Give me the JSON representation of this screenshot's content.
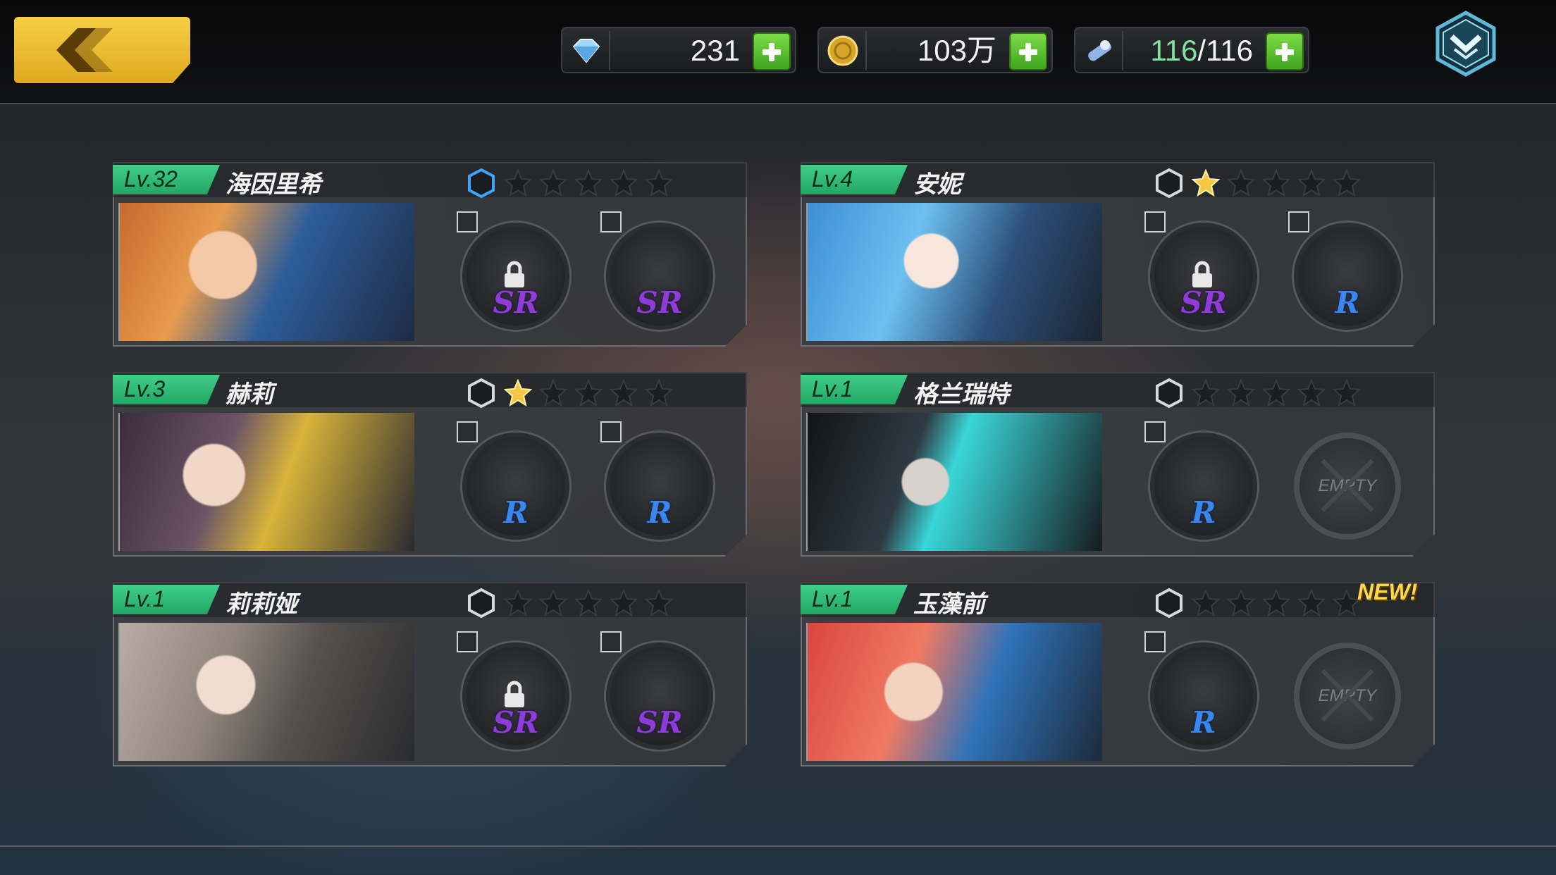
{
  "resources": {
    "diamonds": {
      "icon": "diamond-icon",
      "value": "231"
    },
    "gold": {
      "icon": "gold-coin-icon",
      "value": "103万"
    },
    "stamina": {
      "icon": "stamina-icon",
      "current": "116",
      "max": "116",
      "sep": "/"
    }
  },
  "nav": {
    "back_icon": "back-arrow-icon",
    "menu_icon": "chevron-menu-icon"
  },
  "empty_label": "EMPTY",
  "new_label": "NEW!",
  "characters": [
    {
      "level": "Lv.32",
      "name": "海因里希",
      "stars": 0,
      "hex_active": true,
      "slots": [
        {
          "rank": "SR",
          "locked": true
        },
        {
          "rank": "SR",
          "locked": false
        }
      ],
      "is_new": false
    },
    {
      "level": "Lv.4",
      "name": "安妮",
      "stars": 1,
      "hex_active": false,
      "slots": [
        {
          "rank": "SR",
          "locked": true
        },
        {
          "rank": "R",
          "locked": false
        }
      ],
      "is_new": false
    },
    {
      "level": "Lv.3",
      "name": "赫莉",
      "stars": 1,
      "hex_active": false,
      "slots": [
        {
          "rank": "R",
          "locked": false
        },
        {
          "rank": "R",
          "locked": false
        }
      ],
      "is_new": false
    },
    {
      "level": "Lv.1",
      "name": "格兰瑞特",
      "stars": 0,
      "hex_active": false,
      "slots": [
        {
          "rank": "R",
          "locked": false
        },
        {
          "empty": true
        }
      ],
      "is_new": false
    },
    {
      "level": "Lv.1",
      "name": "莉莉娅",
      "stars": 0,
      "hex_active": false,
      "slots": [
        {
          "rank": "SR",
          "locked": true
        },
        {
          "rank": "SR",
          "locked": false
        }
      ],
      "is_new": false
    },
    {
      "level": "Lv.1",
      "name": "玉藻前",
      "stars": 0,
      "hex_active": false,
      "slots": [
        {
          "rank": "R",
          "locked": false
        },
        {
          "empty": true
        }
      ],
      "is_new": true
    }
  ],
  "colors": {
    "level_badge": "#2fbf78",
    "star_gold": "#f6c744",
    "rank_sr": "#8d3bd9",
    "rank_r": "#3a86f0",
    "plus_green": "#5cc232"
  }
}
